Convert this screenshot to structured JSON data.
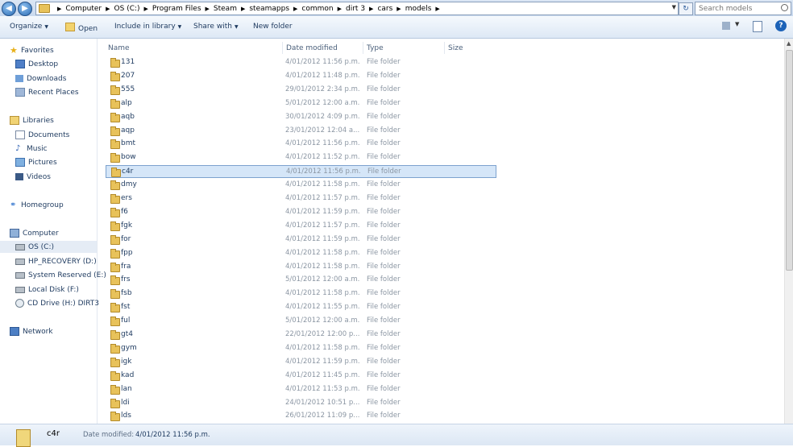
{
  "address": {
    "crumbs": [
      "Computer",
      "OS (C:)",
      "Program Files",
      "Steam",
      "steamapps",
      "common",
      "dirt 3",
      "cars",
      "models"
    ],
    "search_placeholder": "Search models"
  },
  "toolbar": {
    "organize": "Organize",
    "open": "Open",
    "include_library": "Include in library",
    "share_with": "Share with",
    "new_folder": "New folder"
  },
  "nav": {
    "favorites": "Favorites",
    "desktop": "Desktop",
    "downloads": "Downloads",
    "recent": "Recent Places",
    "libraries": "Libraries",
    "documents": "Documents",
    "music": "Music",
    "pictures": "Pictures",
    "videos": "Videos",
    "homegroup": "Homegroup",
    "computer": "Computer",
    "drives": [
      "OS (C:)",
      "HP_RECOVERY (D:)",
      "System Reserved (E:)",
      "Local Disk (F:)",
      "CD Drive (H:) DIRT3"
    ],
    "network": "Network"
  },
  "columns": {
    "name": "Name",
    "date": "Date modified",
    "type": "Type",
    "size": "Size"
  },
  "files": [
    {
      "name": "131",
      "date": "4/01/2012 11:56 p.m.",
      "type": "File folder"
    },
    {
      "name": "207",
      "date": "4/01/2012 11:48 p.m.",
      "type": "File folder"
    },
    {
      "name": "555",
      "date": "29/01/2012 2:34 p.m.",
      "type": "File folder"
    },
    {
      "name": "alp",
      "date": "5/01/2012 12:00 a.m.",
      "type": "File folder"
    },
    {
      "name": "aqb",
      "date": "30/01/2012 4:09 p.m.",
      "type": "File folder"
    },
    {
      "name": "aqp",
      "date": "23/01/2012 12:04 a...",
      "type": "File folder"
    },
    {
      "name": "bmt",
      "date": "4/01/2012 11:56 p.m.",
      "type": "File folder"
    },
    {
      "name": "bow",
      "date": "4/01/2012 11:52 p.m.",
      "type": "File folder"
    },
    {
      "name": "c4r",
      "date": "4/01/2012 11:56 p.m.",
      "type": "File folder"
    },
    {
      "name": "dmy",
      "date": "4/01/2012 11:58 p.m.",
      "type": "File folder"
    },
    {
      "name": "ers",
      "date": "4/01/2012 11:57 p.m.",
      "type": "File folder"
    },
    {
      "name": "f6",
      "date": "4/01/2012 11:59 p.m.",
      "type": "File folder"
    },
    {
      "name": "fgk",
      "date": "4/01/2012 11:57 p.m.",
      "type": "File folder"
    },
    {
      "name": "for",
      "date": "4/01/2012 11:59 p.m.",
      "type": "File folder"
    },
    {
      "name": "fpp",
      "date": "4/01/2012 11:58 p.m.",
      "type": "File folder"
    },
    {
      "name": "fra",
      "date": "4/01/2012 11:58 p.m.",
      "type": "File folder"
    },
    {
      "name": "frs",
      "date": "5/01/2012 12:00 a.m.",
      "type": "File folder"
    },
    {
      "name": "fsb",
      "date": "4/01/2012 11:58 p.m.",
      "type": "File folder"
    },
    {
      "name": "fst",
      "date": "4/01/2012 11:55 p.m.",
      "type": "File folder"
    },
    {
      "name": "ful",
      "date": "5/01/2012 12:00 a.m.",
      "type": "File folder"
    },
    {
      "name": "gt4",
      "date": "22/01/2012 12:00 p...",
      "type": "File folder"
    },
    {
      "name": "gym",
      "date": "4/01/2012 11:58 p.m.",
      "type": "File folder"
    },
    {
      "name": "igk",
      "date": "4/01/2012 11:59 p.m.",
      "type": "File folder"
    },
    {
      "name": "kad",
      "date": "4/01/2012 11:45 p.m.",
      "type": "File folder"
    },
    {
      "name": "lan",
      "date": "4/01/2012 11:53 p.m.",
      "type": "File folder"
    },
    {
      "name": "ldi",
      "date": "24/01/2012 10:51 p...",
      "type": "File folder"
    },
    {
      "name": "lds",
      "date": "26/01/2012 11:09 p...",
      "type": "File folder"
    }
  ],
  "selected_index": 8,
  "details": {
    "name": "c4r",
    "label": "Date modified:",
    "value": "4/01/2012 11:56 p.m."
  }
}
